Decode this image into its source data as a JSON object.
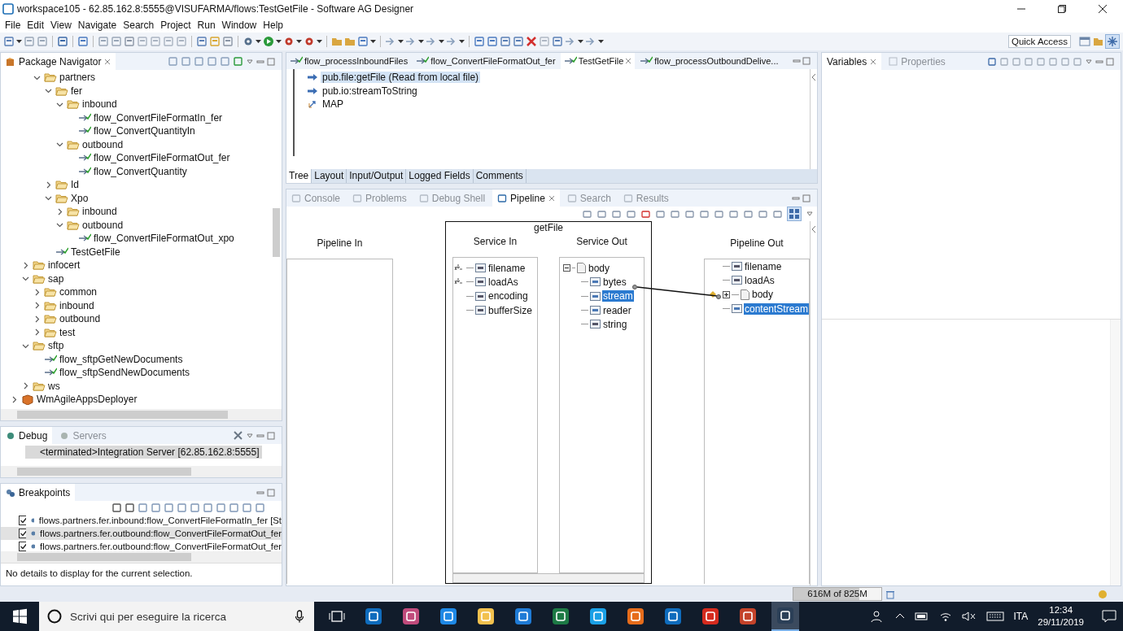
{
  "window": {
    "title": "workspace105 - 62.85.162.8:5555@VISUFARMA/flows:TestGetFile - Software AG Designer"
  },
  "menu": [
    "File",
    "Edit",
    "View",
    "Navigate",
    "Search",
    "Project",
    "Run",
    "Window",
    "Help"
  ],
  "quick_access": {
    "label": "Quick Access"
  },
  "navigator": {
    "title": "Package Navigator",
    "tree": [
      {
        "children": [
          {
            "children": [
              {
                "label": "partners",
                "kind": "folder",
                "expanded": true,
                "children": [
                  {
                    "label": "fer",
                    "kind": "folder",
                    "expanded": true,
                    "children": [
                      {
                        "label": "inbound",
                        "kind": "folder",
                        "expanded": true,
                        "children": [
                          {
                            "label": "flow_ConvertFileFormatIn_fer",
                            "kind": "flow"
                          },
                          {
                            "label": "flow_ConvertQuantityIn",
                            "kind": "flow"
                          }
                        ]
                      },
                      {
                        "label": "outbound",
                        "kind": "folder",
                        "expanded": true,
                        "children": [
                          {
                            "label": "flow_ConvertFileFormatOut_fer",
                            "kind": "flow"
                          },
                          {
                            "label": "flow_ConvertQuantity",
                            "kind": "flow"
                          }
                        ]
                      }
                    ]
                  },
                  {
                    "label": "Id",
                    "kind": "folder",
                    "expanded": false
                  },
                  {
                    "label": "Xpo",
                    "kind": "folder",
                    "expanded": true,
                    "children": [
                      {
                        "label": "inbound",
                        "kind": "folder",
                        "expanded": false
                      },
                      {
                        "label": "outbound",
                        "kind": "folder",
                        "expanded": true,
                        "children": [
                          {
                            "label": "flow_ConvertFileFormatOut_xpo",
                            "kind": "flow"
                          }
                        ]
                      }
                    ]
                  },
                  {
                    "label": "TestGetFile",
                    "kind": "flow"
                  }
                ]
              }
            ]
          },
          {
            "label": "infocert",
            "kind": "folder",
            "expanded": false
          },
          {
            "label": "sap",
            "kind": "folder",
            "expanded": true,
            "children": [
              {
                "label": "common",
                "kind": "folder",
                "expanded": false
              },
              {
                "label": "inbound",
                "kind": "folder",
                "expanded": false
              },
              {
                "label": "outbound",
                "kind": "folder",
                "expanded": false
              },
              {
                "label": "test",
                "kind": "folder",
                "expanded": false
              }
            ]
          },
          {
            "label": "sftp",
            "kind": "folder",
            "expanded": true,
            "children": [
              {
                "label": "flow_sftpGetNewDocuments",
                "kind": "flow"
              },
              {
                "label": "flow_sftpSendNewDocuments",
                "kind": "flow"
              }
            ]
          },
          {
            "label": "ws",
            "kind": "folder",
            "expanded": false
          }
        ]
      },
      {
        "label": "WmAgileAppsDeployer",
        "kind": "package",
        "expanded": false
      }
    ]
  },
  "debug": {
    "tabs": [
      {
        "label": "Debug",
        "selected": true
      },
      {
        "label": "Servers",
        "selected": false
      }
    ],
    "items": [
      {
        "label": "<terminated>Integration Server [62.85.162.8:5555]",
        "selected": true
      }
    ]
  },
  "breakpoints": {
    "title": "Breakpoints",
    "rows": [
      {
        "label": "flows.partners.fer.inbound:flow_ConvertFileFormatIn_fer [St",
        "checked": true,
        "selected": false
      },
      {
        "label": "flows.partners.fer.outbound:flow_ConvertFileFormatOut_fer",
        "checked": true,
        "selected": true
      },
      {
        "label": "flows.partners.fer.outbound:flow_ConvertFileFormatOut_fer",
        "checked": true,
        "selected": false
      }
    ],
    "details": "No details to display for the current selection."
  },
  "editor": {
    "tabs": [
      {
        "label": "flow_processInboundFiles",
        "selected": false
      },
      {
        "label": "flow_ConvertFileFormatOut_fer",
        "selected": false
      },
      {
        "label": "TestGetFile",
        "selected": true
      },
      {
        "label": "flow_processOutboundDelive...",
        "selected": false
      }
    ],
    "steps": [
      {
        "label": "pub.file:getFile (Read from local file)",
        "kind": "invoke",
        "selected": true
      },
      {
        "label": "pub.io:streamToString",
        "kind": "invoke",
        "selected": false
      },
      {
        "label": "MAP",
        "kind": "map",
        "selected": false
      }
    ],
    "bottom_tabs": [
      {
        "label": "Tree",
        "selected": true
      },
      {
        "label": "Layout",
        "selected": false
      },
      {
        "label": "Input/Output",
        "selected": false
      },
      {
        "label": "Logged Fields",
        "selected": false
      },
      {
        "label": "Comments",
        "selected": false
      }
    ]
  },
  "pipeline_view": {
    "tabs": [
      {
        "label": "Console",
        "selected": false
      },
      {
        "label": "Problems",
        "selected": false
      },
      {
        "label": "Debug Shell",
        "selected": false
      },
      {
        "label": "Pipeline",
        "selected": true
      },
      {
        "label": "Search",
        "selected": false
      },
      {
        "label": "Results",
        "selected": false
      }
    ],
    "pipeline_in": {
      "title": "Pipeline In"
    },
    "service": {
      "title": "getFile",
      "service_in": {
        "title": "Service In",
        "fields": [
          {
            "name": "filename",
            "kind": "string",
            "selected": false,
            "mapped": true
          },
          {
            "name": "loadAs",
            "kind": "string",
            "selected": false,
            "mapped": true
          },
          {
            "name": "encoding",
            "kind": "string",
            "selected": false,
            "mapped": false
          },
          {
            "name": "bufferSize",
            "kind": "string",
            "selected": false,
            "mapped": false
          }
        ]
      },
      "service_out": {
        "title": "Service Out",
        "fields": [
          {
            "name": "body",
            "kind": "document",
            "selected": false,
            "children": [
              {
                "name": "bytes",
                "kind": "object",
                "selected": false
              },
              {
                "name": "stream",
                "kind": "object",
                "selected": true
              },
              {
                "name": "reader",
                "kind": "object",
                "selected": false
              },
              {
                "name": "string",
                "kind": "string",
                "selected": false
              }
            ]
          }
        ]
      }
    },
    "pipeline_out": {
      "title": "Pipeline Out",
      "fields": [
        {
          "name": "filename",
          "kind": "string",
          "selected": false
        },
        {
          "name": "loadAs",
          "kind": "string",
          "selected": false
        },
        {
          "name": "body",
          "kind": "document",
          "selected": false,
          "collapsed": true
        },
        {
          "name": "contentStream",
          "kind": "object",
          "selected": true
        }
      ]
    }
  },
  "variables": {
    "tabs": [
      {
        "label": "Variables",
        "selected": true
      },
      {
        "label": "Properties",
        "selected": false
      }
    ]
  },
  "status_bar": {
    "memory": "616M of 825M",
    "level": 0.75
  },
  "taskbar": {
    "search_placeholder": "Scrivi qui per eseguire la ricerca",
    "language": "ITA",
    "time": "12:34",
    "date": "29/11/2019"
  }
}
